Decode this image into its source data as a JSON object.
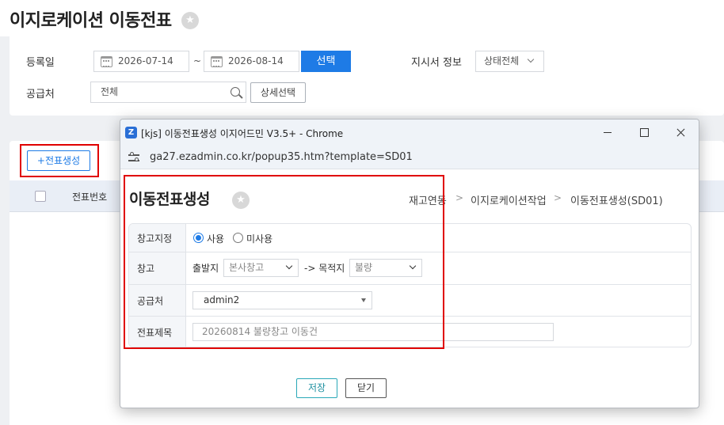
{
  "page": {
    "title": "이지로케이션 이동전표",
    "filters": {
      "reg_date_label": "등록일",
      "date_from": "2026-07-14",
      "date_sep": "~",
      "date_to": "2026-08-14",
      "select_button": "선택",
      "order_info_label": "지시서 정보",
      "status_select": "상태전체",
      "supplier_label": "공급처",
      "supplier_value": "전체",
      "detail_select_button": "상세선택"
    },
    "list": {
      "create_button": "+전표생성",
      "columns": [
        "전표번호"
      ]
    }
  },
  "popup": {
    "window_title": "[kjs] 이동전표생성 이지어드민 V3.5+ - Chrome",
    "app_icon_letter": "Z",
    "url": "ga27.ezadmin.co.kr/popup35.htm?template=SD01",
    "title": "이동전표생성",
    "breadcrumb": [
      "재고연동",
      "이지로케이션작업",
      "이동전표생성(SD01)"
    ],
    "form": {
      "warehouse_assign": {
        "label": "창고지정",
        "options": [
          "사용",
          "미사용"
        ],
        "selected": "사용"
      },
      "warehouse": {
        "label": "창고",
        "from_label": "출발지",
        "from_value": "본사창고",
        "arrow_label": "-> 목적지",
        "to_value": "불량"
      },
      "supplier": {
        "label": "공급처",
        "value": "admin2"
      },
      "slip_title": {
        "label": "전표제목",
        "placeholder": "20260814 불량창고 이동건"
      }
    },
    "buttons": {
      "save": "저장",
      "close": "닫기"
    }
  },
  "colors": {
    "primary": "#1e7be6",
    "highlight_red": "#e00000",
    "save_teal": "#2aa8b8"
  }
}
